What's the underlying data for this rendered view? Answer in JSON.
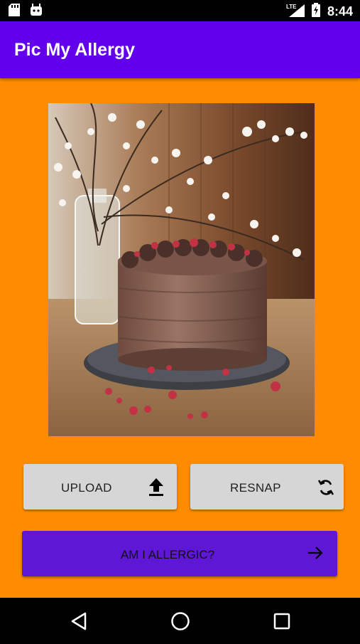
{
  "status_bar": {
    "time": "8:44",
    "network": "LTE"
  },
  "app_bar": {
    "title": "Pic My Allergy"
  },
  "photo": {
    "subject": "chocolate cake photo"
  },
  "buttons": {
    "upload_label": "UPLOAD",
    "resnap_label": "RESNAP",
    "allergic_label": "AM I ALLERGIC?"
  },
  "colors": {
    "background": "#ff8c00",
    "primary": "#6200ee",
    "button_gray": "#d6d6d6",
    "accent_button": "#5f17d6"
  },
  "icons": {
    "upload": "upload-icon",
    "resnap": "refresh-icon",
    "allergic": "arrow-right-icon"
  }
}
